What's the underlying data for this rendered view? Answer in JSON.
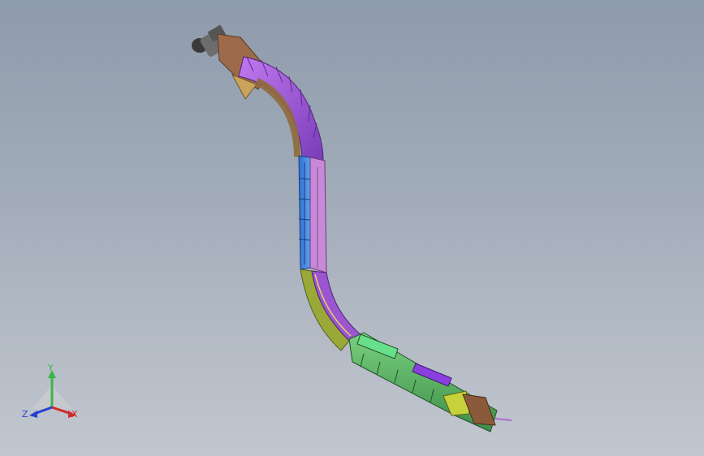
{
  "view": {
    "background_top": "#8e9bab",
    "background_bottom": "#c2c7cf"
  },
  "model": {
    "segment_colors": {
      "top_curve": "#a24be0",
      "top_curve_side": "#8f6a3a",
      "vertical_left": "#3b7fe0",
      "vertical_right": "#c88ad8",
      "lower_curve": "#9b55d0",
      "lower_curve_side": "#9aa838",
      "horizontal_run": "#5fb36a",
      "horizontal_accent": "#66e08a",
      "tail_box": "#c7d23a",
      "tail_end": "#8a5a3a"
    }
  },
  "triad": {
    "x_label": "X",
    "y_label": "Y",
    "z_label": "Z",
    "x_color": "#d02a2a",
    "y_color": "#3bb54a",
    "z_color": "#2a3fd0"
  }
}
